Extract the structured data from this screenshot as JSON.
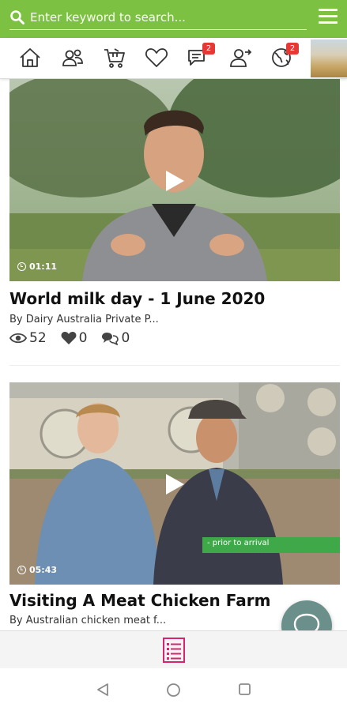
{
  "colors": {
    "brand_green": "#7dc142",
    "badge_red": "#e53935",
    "fab": "#6b8f8a",
    "list_pink": "#d6246e"
  },
  "search": {
    "placeholder": "Enter keyword to search...",
    "icon": "search-icon"
  },
  "menu": {
    "icon": "hamburger-menu-icon"
  },
  "nav": {
    "items": [
      {
        "name": "home",
        "icon": "home-icon"
      },
      {
        "name": "people",
        "icon": "users-icon"
      },
      {
        "name": "cart",
        "icon": "cart-icon"
      },
      {
        "name": "favorites",
        "icon": "heart-icon"
      },
      {
        "name": "messages",
        "icon": "chat-icon",
        "badge": "2"
      },
      {
        "name": "profile",
        "icon": "user-switch-icon"
      },
      {
        "name": "globe",
        "icon": "globe-icon",
        "badge": "2"
      }
    ]
  },
  "feed": {
    "videos": [
      {
        "duration": "01:11",
        "title": "World milk day - 1 June 2020",
        "author": "By Dairy Australia Private P...",
        "views": "52",
        "likes": "0",
        "comments": "0"
      },
      {
        "duration": "05:43",
        "title": "Visiting A Meat Chicken Farm",
        "author": "By Australian chicken meat f...",
        "overlay_caption": "- prior to arrival"
      }
    ]
  },
  "bottom": {
    "icon": "list-icon"
  },
  "system_nav": {
    "back": "back-triangle-icon",
    "home": "home-circle-icon",
    "recents": "recents-square-icon"
  }
}
